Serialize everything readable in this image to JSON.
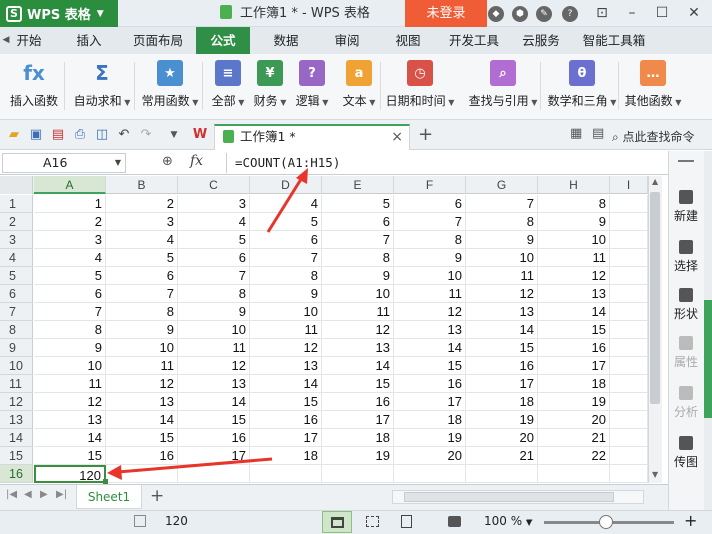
{
  "titlebar": {
    "app_name": "WPS 表格",
    "logo_letter": "S",
    "doc_title": "工作簿1 * - WPS 表格",
    "login_label": "未登录"
  },
  "ribbon_tabs": [
    "开始",
    "插入",
    "页面布局",
    "公式",
    "数据",
    "审阅",
    "视图",
    "开发工具",
    "云服务",
    "智能工具箱"
  ],
  "active_tab": "公式",
  "ribbon_groups": [
    {
      "label": "插入函数",
      "icon": "fx-icon",
      "color": "#4a8fd0",
      "glyph": "fx",
      "dropdown": false
    },
    {
      "label": "自动求和",
      "icon": "sigma-icon",
      "color": "#3b74c2",
      "glyph": "Σ",
      "dropdown": true
    },
    {
      "label": "常用函数",
      "icon": "star-function-icon",
      "color": "#4a8fd0",
      "glyph": "★",
      "dropdown": true
    },
    {
      "label": "全部",
      "icon": "all-functions-icon",
      "color": "#5b77c9",
      "glyph": "≡",
      "dropdown": true
    },
    {
      "label": "财务",
      "icon": "finance-icon",
      "color": "#3c9a56",
      "glyph": "¥",
      "dropdown": true
    },
    {
      "label": "逻辑",
      "icon": "logic-icon",
      "color": "#9867c5",
      "glyph": "?",
      "dropdown": true
    },
    {
      "label": "文本",
      "icon": "text-icon",
      "color": "#f0a234",
      "glyph": "a",
      "dropdown": true
    },
    {
      "label": "日期和时间",
      "icon": "clock-icon",
      "color": "#d95247",
      "glyph": "◷",
      "dropdown": true
    },
    {
      "label": "查找与引用",
      "icon": "lookup-icon",
      "color": "#b16dd1",
      "glyph": "⌕",
      "dropdown": true
    },
    {
      "label": "数学和三角",
      "icon": "math-icon",
      "color": "#6b6fcf",
      "glyph": "θ",
      "dropdown": true
    },
    {
      "label": "其他函数",
      "icon": "other-functions-icon",
      "color": "#f08a4a",
      "glyph": "…",
      "dropdown": true
    }
  ],
  "doc_tab": {
    "label": "工作簿1 *",
    "close": "×",
    "new": "+"
  },
  "search_command": "点此查找命令",
  "formula_bar": {
    "name_box": "A16",
    "fx": "fx",
    "formula": "=COUNT(A1:H15)"
  },
  "columns": [
    "A",
    "B",
    "C",
    "D",
    "E",
    "F",
    "G",
    "H",
    "I"
  ],
  "rows": [
    [
      1,
      2,
      3,
      4,
      5,
      6,
      7,
      8
    ],
    [
      2,
      3,
      4,
      5,
      6,
      7,
      8,
      9
    ],
    [
      3,
      4,
      5,
      6,
      7,
      8,
      9,
      10
    ],
    [
      4,
      5,
      6,
      7,
      8,
      9,
      10,
      11
    ],
    [
      5,
      6,
      7,
      8,
      9,
      10,
      11,
      12
    ],
    [
      6,
      7,
      8,
      9,
      10,
      11,
      12,
      13
    ],
    [
      7,
      8,
      9,
      10,
      11,
      12,
      13,
      14
    ],
    [
      8,
      9,
      10,
      11,
      12,
      13,
      14,
      15
    ],
    [
      9,
      10,
      11,
      12,
      13,
      14,
      15,
      16
    ],
    [
      10,
      11,
      12,
      13,
      14,
      15,
      16,
      17
    ],
    [
      11,
      12,
      13,
      14,
      15,
      16,
      17,
      18
    ],
    [
      12,
      13,
      14,
      15,
      16,
      17,
      18,
      19
    ],
    [
      13,
      14,
      15,
      16,
      17,
      18,
      19,
      20
    ],
    [
      14,
      15,
      16,
      17,
      18,
      19,
      20,
      21
    ],
    [
      15,
      16,
      17,
      18,
      19,
      20,
      21,
      22
    ]
  ],
  "row_numbers": [
    "1",
    "2",
    "3",
    "4",
    "5",
    "6",
    "7",
    "8",
    "9",
    "10",
    "11",
    "12",
    "13",
    "14",
    "15",
    "16"
  ],
  "result": {
    "row": "16",
    "value": "120"
  },
  "right_panel": [
    {
      "label": "新建",
      "enabled": true
    },
    {
      "label": "选择",
      "enabled": true
    },
    {
      "label": "形状",
      "enabled": true
    },
    {
      "label": "属性",
      "enabled": false
    },
    {
      "label": "分析",
      "enabled": false
    },
    {
      "label": "传图",
      "enabled": true
    }
  ],
  "sheet_tab": "Sheet1",
  "add_sheet": "+",
  "status": {
    "sum": "120",
    "zoom": "100 %",
    "zoom_level_pct": 100
  },
  "annotation_color": "#e8352b",
  "accent_color": "#3fa45b"
}
